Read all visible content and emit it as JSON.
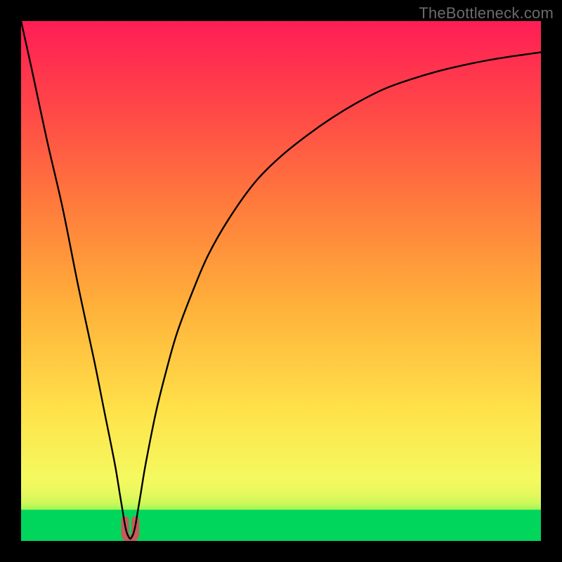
{
  "watermark": "TheBottleneck.com",
  "chart_data": {
    "type": "line",
    "title": "",
    "xlabel": "",
    "ylabel": "",
    "xlim": [
      0,
      100
    ],
    "ylim": [
      0,
      100
    ],
    "grid": false,
    "legend": false,
    "series": [
      {
        "name": "curve",
        "x": [
          0,
          2,
          5,
          8,
          11,
          14,
          16,
          18,
          19,
          19.5,
          20,
          20.4,
          20.8,
          21,
          21.2,
          21.6,
          22,
          22.5,
          23,
          24,
          26,
          28,
          30,
          33,
          36,
          40,
          45,
          50,
          55,
          60,
          65,
          70,
          75,
          80,
          85,
          90,
          95,
          100
        ],
        "y": [
          100,
          91,
          77,
          64,
          49,
          35,
          25,
          15,
          9,
          6,
          3,
          1.4,
          0.6,
          0.4,
          0.6,
          1.4,
          3,
          6,
          9,
          15,
          25,
          33,
          40,
          48,
          55,
          62,
          69,
          74,
          78,
          81.5,
          84.5,
          87,
          88.8,
          90.3,
          91.5,
          92.5,
          93.3,
          94
        ]
      }
    ],
    "green_band": {
      "y_start": 0,
      "y_end": 6
    },
    "fade_band": {
      "y_start": 6,
      "y_end": 13
    },
    "marker": {
      "name": "bottleneck-minimum",
      "shape": "u",
      "color": "#c85a5a",
      "x_center": 21,
      "x_half_width": 1.0,
      "y_bottom": 0.4,
      "y_top": 4.0
    },
    "gradient_stops": [
      {
        "offset": 0.0,
        "color": "#00e264"
      },
      {
        "offset": 0.035,
        "color": "#5fef4a"
      },
      {
        "offset": 0.075,
        "color": "#c8f85a"
      },
      {
        "offset": 0.12,
        "color": "#f4f95f"
      },
      {
        "offset": 0.25,
        "color": "#ffe24a"
      },
      {
        "offset": 0.45,
        "color": "#ffb13a"
      },
      {
        "offset": 0.65,
        "color": "#ff7a3c"
      },
      {
        "offset": 0.82,
        "color": "#ff4a47"
      },
      {
        "offset": 1.0,
        "color": "#ff1d55"
      }
    ]
  }
}
